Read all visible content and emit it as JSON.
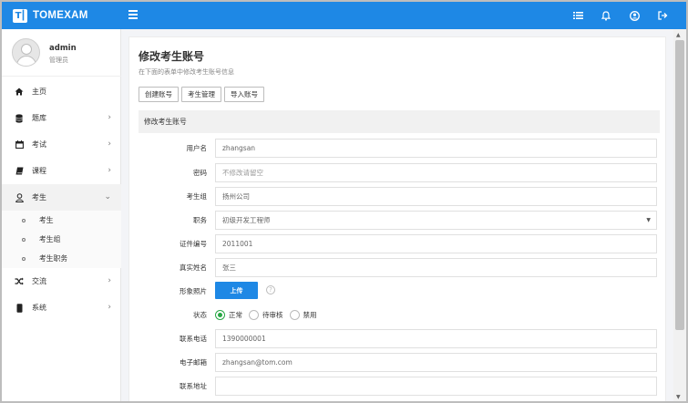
{
  "header": {
    "brand_logo": "T┃",
    "brand_name": "TOMEXAM",
    "icons": [
      "menu-icon",
      "list-icon",
      "bell-icon",
      "user-icon",
      "logout-icon"
    ]
  },
  "user": {
    "name": "admin",
    "role": "管理员"
  },
  "sidebar": {
    "items": [
      {
        "label": "主页"
      },
      {
        "label": "题库"
      },
      {
        "label": "考试"
      },
      {
        "label": "课程"
      },
      {
        "label": "考生"
      },
      {
        "label": "交流"
      },
      {
        "label": "系统"
      }
    ],
    "sub_items": [
      {
        "label": "考生"
      },
      {
        "label": "考生组"
      },
      {
        "label": "考生职务"
      }
    ]
  },
  "page": {
    "title": "修改考生账号",
    "subtitle": "在下面的表单中修改考生账号信息",
    "buttons": [
      "创建账号",
      "考生管理",
      "导入账号"
    ],
    "section_title": "修改考生账号"
  },
  "form": {
    "username": {
      "label": "用户名",
      "value": "zhangsan"
    },
    "password": {
      "label": "密码",
      "placeholder": "不修改请留空"
    },
    "group": {
      "label": "考生组",
      "value": "扬州公司"
    },
    "position": {
      "label": "职务",
      "value": "初级开发工程师"
    },
    "cert_no": {
      "label": "证件编号",
      "value": "2011001"
    },
    "real_name": {
      "label": "真实姓名",
      "value": "张三"
    },
    "photo": {
      "label": "形象照片",
      "button": "上传",
      "help": "?"
    },
    "status": {
      "label": "状态",
      "options": [
        "正常",
        "待审核",
        "禁用"
      ],
      "selected": "正常"
    },
    "phone": {
      "label": "联系电话",
      "value": "1390000001"
    },
    "email": {
      "label": "电子邮箱",
      "value": "zhangsan@tom.com"
    },
    "address": {
      "label": "联系地址",
      "value": ""
    }
  },
  "colors": {
    "primary": "#1e88e5",
    "radio_on": "#28a745"
  }
}
